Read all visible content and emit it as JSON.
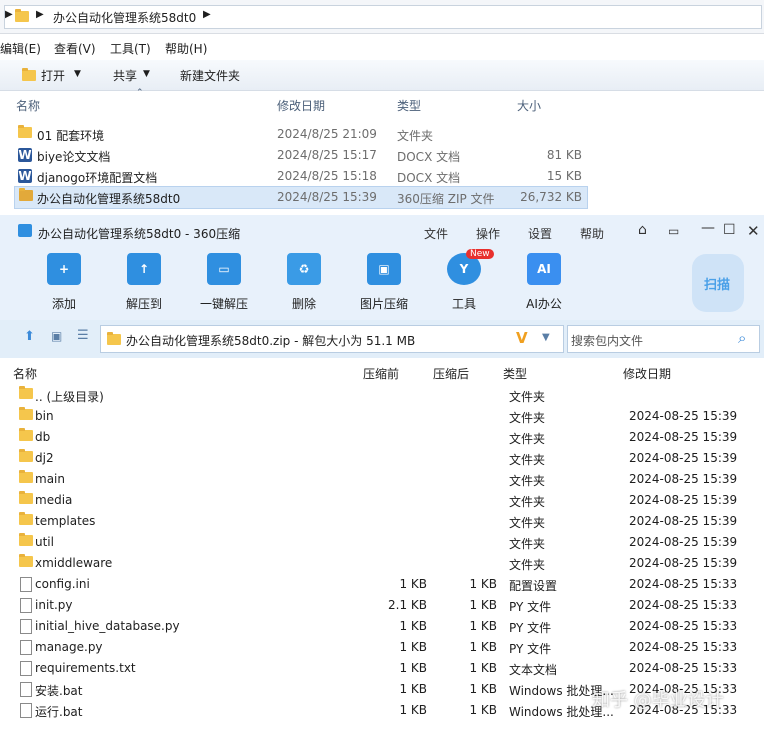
{
  "explorer": {
    "breadcrumb": "办公自动化管理系统58dt0",
    "menu": [
      "编辑(E)",
      "查看(V)",
      "工具(T)",
      "帮助(H)"
    ],
    "toolbar": {
      "open": "打开",
      "share": "共享",
      "new_folder": "新建文件夹"
    },
    "columns": {
      "name": "名称",
      "modified": "修改日期",
      "type": "类型",
      "size": "大小"
    },
    "files": [
      {
        "name": "01 配套环境",
        "modified": "2024/8/25 21:09",
        "type": "文件夹",
        "size": ""
      },
      {
        "name": "biye论文文档",
        "modified": "2024/8/25 15:17",
        "type": "DOCX 文档",
        "size": "81 KB"
      },
      {
        "name": "djanogo环境配置文档",
        "modified": "2024/8/25 15:18",
        "type": "DOCX 文档",
        "size": "15 KB"
      },
      {
        "name": "办公自动化管理系统58dt0",
        "modified": "2024/8/25 15:39",
        "type": "360压缩 ZIP 文件",
        "size": "26,732 KB"
      }
    ]
  },
  "zip": {
    "title": "办公自动化管理系统58dt0 - 360压缩",
    "menu": {
      "file": "文件",
      "ops": "操作",
      "settings": "设置",
      "help": "帮助"
    },
    "tools": [
      {
        "label": "添加",
        "color": "#2f8fe0",
        "glyph": "+"
      },
      {
        "label": "解压到",
        "color": "#2f8fe0",
        "glyph": "↑"
      },
      {
        "label": "一键解压",
        "color": "#2f8fe0",
        "glyph": "▭"
      },
      {
        "label": "删除",
        "color": "#3a9be6",
        "glyph": "♻"
      },
      {
        "label": "图片压缩",
        "color": "#2f8fe0",
        "glyph": "▣"
      },
      {
        "label": "工具",
        "color": "#2f8fe0",
        "glyph": "Y"
      },
      {
        "label": "AI办公",
        "color": "#3a8ff0",
        "glyph": "AI"
      }
    ],
    "new_badge": "New",
    "scan": "扫描",
    "path": "办公自动化管理系统58dt0.zip - 解包大小为 51.1 MB",
    "search_placeholder": "搜索包内文件",
    "columns": {
      "name": "名称",
      "compressed": "压缩前",
      "after": "压缩后",
      "type": "类型",
      "modified": "修改日期"
    },
    "rows": [
      {
        "name": ".. (上级目录)",
        "before": "",
        "after": "",
        "type": "文件夹",
        "date": "",
        "kind": "folder"
      },
      {
        "name": "bin",
        "before": "",
        "after": "",
        "type": "文件夹",
        "date": "2024-08-25 15:39",
        "kind": "folder"
      },
      {
        "name": "db",
        "before": "",
        "after": "",
        "type": "文件夹",
        "date": "2024-08-25 15:39",
        "kind": "folder"
      },
      {
        "name": "dj2",
        "before": "",
        "after": "",
        "type": "文件夹",
        "date": "2024-08-25 15:39",
        "kind": "folder"
      },
      {
        "name": "main",
        "before": "",
        "after": "",
        "type": "文件夹",
        "date": "2024-08-25 15:39",
        "kind": "folder"
      },
      {
        "name": "media",
        "before": "",
        "after": "",
        "type": "文件夹",
        "date": "2024-08-25 15:39",
        "kind": "folder"
      },
      {
        "name": "templates",
        "before": "",
        "after": "",
        "type": "文件夹",
        "date": "2024-08-25 15:39",
        "kind": "folder"
      },
      {
        "name": "util",
        "before": "",
        "after": "",
        "type": "文件夹",
        "date": "2024-08-25 15:39",
        "kind": "folder"
      },
      {
        "name": "xmiddleware",
        "before": "",
        "after": "",
        "type": "文件夹",
        "date": "2024-08-25 15:39",
        "kind": "folder"
      },
      {
        "name": "config.ini",
        "before": "1 KB",
        "after": "1 KB",
        "type": "配置设置",
        "date": "2024-08-25 15:33",
        "kind": "file"
      },
      {
        "name": "init.py",
        "before": "2.1 KB",
        "after": "1 KB",
        "type": "PY 文件",
        "date": "2024-08-25 15:33",
        "kind": "file"
      },
      {
        "name": "initial_hive_database.py",
        "before": "1 KB",
        "after": "1 KB",
        "type": "PY 文件",
        "date": "2024-08-25 15:33",
        "kind": "file"
      },
      {
        "name": "manage.py",
        "before": "1 KB",
        "after": "1 KB",
        "type": "PY 文件",
        "date": "2024-08-25 15:33",
        "kind": "file"
      },
      {
        "name": "requirements.txt",
        "before": "1 KB",
        "after": "1 KB",
        "type": "文本文档",
        "date": "2024-08-25 15:33",
        "kind": "file"
      },
      {
        "name": "安装.bat",
        "before": "1 KB",
        "after": "1 KB",
        "type": "Windows 批处理...",
        "date": "2024-08-25 15:33",
        "kind": "file"
      },
      {
        "name": "运行.bat",
        "before": "1 KB",
        "after": "1 KB",
        "type": "Windows 批处理...",
        "date": "2024-08-25 15:33",
        "kind": "file"
      }
    ]
  },
  "watermark": "知乎 @毕业设计"
}
